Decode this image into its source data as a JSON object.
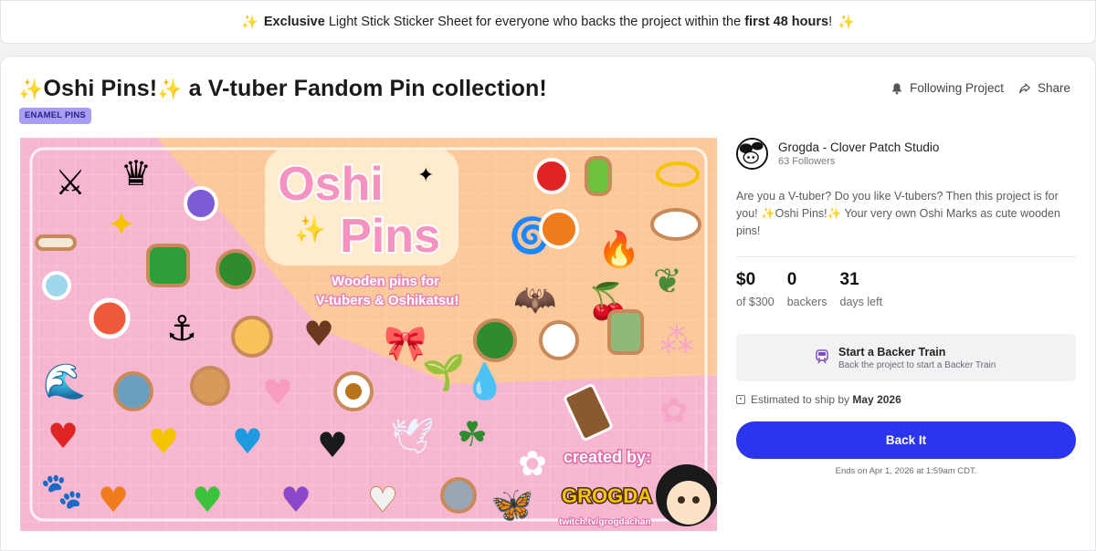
{
  "banner": {
    "exclusive": "Exclusive",
    "middle": " Light Stick Sticker Sheet for everyone who backs the project within the ",
    "hours": "first 48 hours",
    "end": "!"
  },
  "project": {
    "title_spark": "✨",
    "title_main": "Oshi Pins!",
    "title_rest": " a V-tuber Fandom Pin collection!",
    "tag": "ENAMEL PINS"
  },
  "actions": {
    "follow": "Following Project",
    "share": "Share"
  },
  "hero": {
    "logo_line1": "Oshi",
    "logo_line2": "Pins",
    "tagline1": "Wooden pins for",
    "tagline2": "V-tubers & Oshikatsu!",
    "created_by": "created by:",
    "artist_logo": "GROGDA",
    "url": "twitch.tv/grogdachan"
  },
  "creator": {
    "name": "Grogda - Clover Patch Studio",
    "followers": "63 Followers"
  },
  "description": "Are you a V-tuber? Do you like V-tubers? Then this project is for you! ✨Oshi Pins!✨ Your very own Oshi Marks as cute wooden pins!",
  "stats": [
    {
      "value": "$0",
      "label": "of $300"
    },
    {
      "value": "0",
      "label": "backers"
    },
    {
      "value": "31",
      "label": "days left"
    }
  ],
  "train": {
    "title": "Start a Backer Train",
    "subtitle": "Back the project to start a Backer Train"
  },
  "shipping": {
    "prefix": "Estimated to ship by ",
    "date": "May 2026"
  },
  "back_button": "Back It",
  "ends": "Ends on Apr 1, 2026 at 1:59am CDT.",
  "colors": {
    "accent": "#2c35ee",
    "tag_bg": "#a79df2",
    "hero_pink": "#f7b6cf",
    "hero_peach": "#fbc89a"
  }
}
